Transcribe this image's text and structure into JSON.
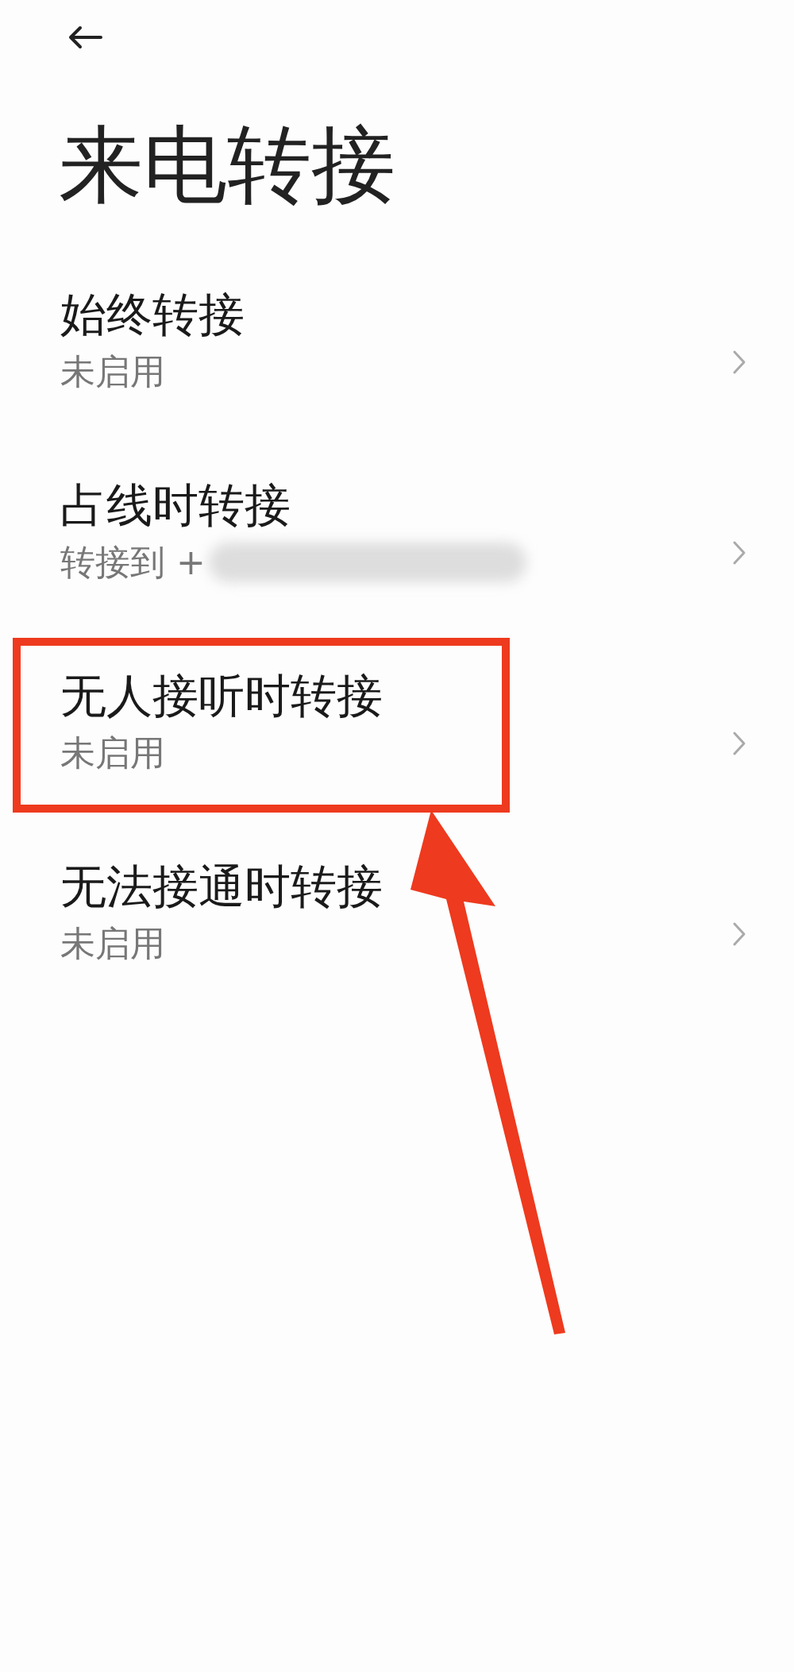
{
  "header": {
    "title": "来电转接"
  },
  "items": [
    {
      "title": "始终转接",
      "status": "未启用",
      "blurred": false,
      "highlighted": false
    },
    {
      "title": "占线时转接",
      "status": "转接到 +",
      "blurred": true,
      "highlighted": false
    },
    {
      "title": "无人接听时转接",
      "status": "未启用",
      "blurred": false,
      "highlighted": true
    },
    {
      "title": "无法接通时转接",
      "status": "未启用",
      "blurred": false,
      "highlighted": false
    }
  ]
}
